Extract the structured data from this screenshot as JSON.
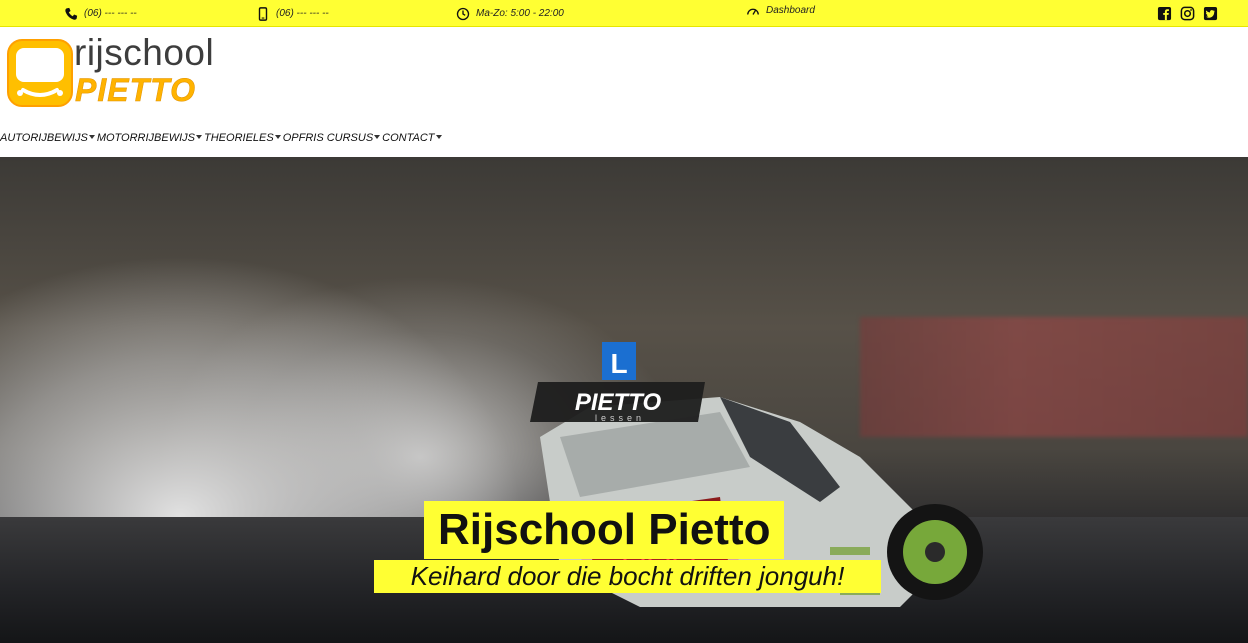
{
  "topbar": {
    "phone": "(06) --- --- --",
    "mobile": "(06) --- --- --",
    "hours": "Ma-Zo: 5:00 - 22:00",
    "dashboard": "Dashboard",
    "social": [
      "facebook-icon",
      "instagram-icon",
      "twitter-icon"
    ],
    "background": "#ffff33"
  },
  "logo": {
    "top": "rijschool",
    "bottom": "PIETTO"
  },
  "nav": {
    "items": [
      {
        "label": "AUTORIJBEWIJS"
      },
      {
        "label": "MOTORRIJBEWIJS"
      },
      {
        "label": "THEORIELES"
      },
      {
        "label": "OPFRIS CURSUS"
      },
      {
        "label": "CONTACT"
      }
    ]
  },
  "hero": {
    "title": "Rijschool Pietto",
    "subtitle": "Keihard door die bocht driften jonguh!",
    "roof_sign": "PIETTO",
    "roof_sign_sub": "lessen",
    "l_plate": "L"
  },
  "colors": {
    "accent": "#ffff33",
    "brand_orange": "#ffb300"
  }
}
